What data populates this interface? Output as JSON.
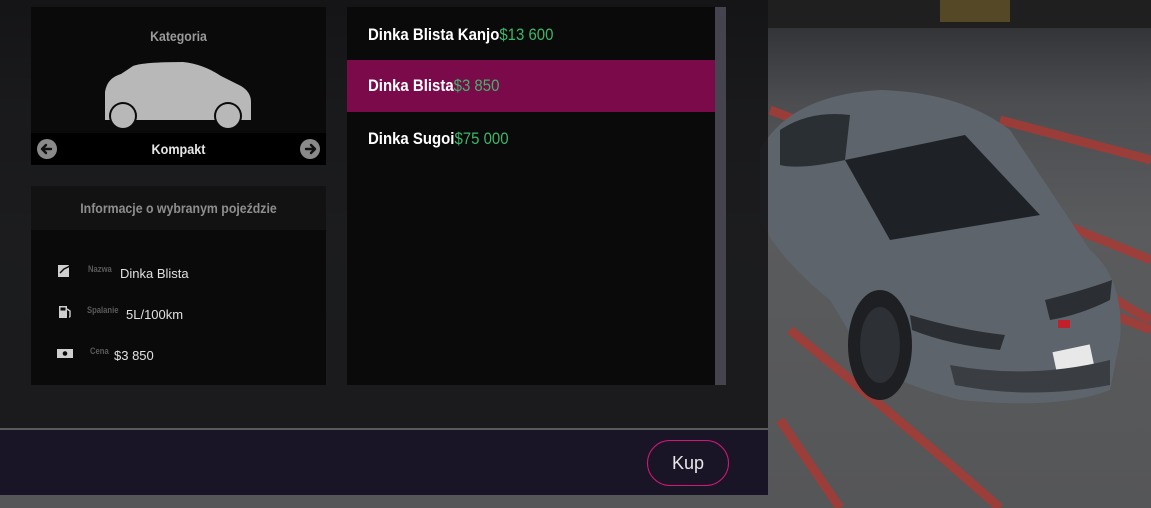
{
  "category": {
    "title": "Kategoria",
    "current": "Kompakt",
    "icons": {
      "prev": "arrow-left-circle-icon",
      "next": "arrow-right-circle-icon",
      "car": "car-silhouette-icon"
    }
  },
  "info": {
    "title": "Informacje o wybranym pojeździe",
    "rows": [
      {
        "icon": "signature-icon",
        "label": "Nazwa",
        "value": "Dinka Blista"
      },
      {
        "icon": "fuel-pump-icon",
        "label": "Spalanie",
        "value": "5L/100km"
      },
      {
        "icon": "money-bill-icon",
        "label": "Cena",
        "value": "$3 850"
      }
    ]
  },
  "vehicles": [
    {
      "name": "Dinka Blista Kanjo",
      "price": "$13 600",
      "selected": false
    },
    {
      "name": "Dinka Blista",
      "price": "$3 850",
      "selected": true
    },
    {
      "name": "Dinka Sugoi",
      "price": "$75 000",
      "selected": false
    }
  ],
  "footer": {
    "buy_label": "Kup"
  },
  "colors": {
    "accent": "#7a0a4a",
    "price": "#3fb56a",
    "button_border": "#d4167a"
  }
}
